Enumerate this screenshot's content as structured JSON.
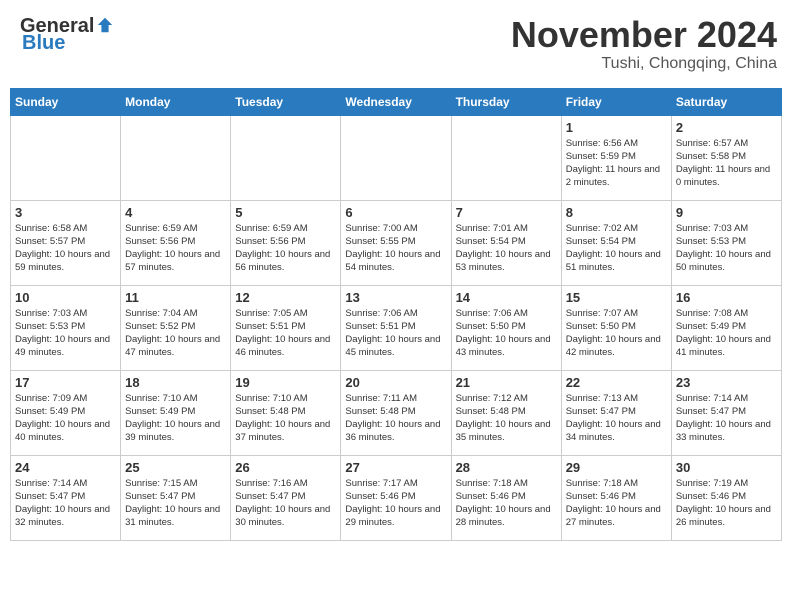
{
  "header": {
    "logo_general": "General",
    "logo_blue": "Blue",
    "month_title": "November 2024",
    "location": "Tushi, Chongqing, China"
  },
  "weekdays": [
    "Sunday",
    "Monday",
    "Tuesday",
    "Wednesday",
    "Thursday",
    "Friday",
    "Saturday"
  ],
  "weeks": [
    [
      {
        "day": "",
        "info": ""
      },
      {
        "day": "",
        "info": ""
      },
      {
        "day": "",
        "info": ""
      },
      {
        "day": "",
        "info": ""
      },
      {
        "day": "",
        "info": ""
      },
      {
        "day": "1",
        "info": "Sunrise: 6:56 AM\nSunset: 5:59 PM\nDaylight: 11 hours and 2 minutes."
      },
      {
        "day": "2",
        "info": "Sunrise: 6:57 AM\nSunset: 5:58 PM\nDaylight: 11 hours and 0 minutes."
      }
    ],
    [
      {
        "day": "3",
        "info": "Sunrise: 6:58 AM\nSunset: 5:57 PM\nDaylight: 10 hours and 59 minutes."
      },
      {
        "day": "4",
        "info": "Sunrise: 6:59 AM\nSunset: 5:56 PM\nDaylight: 10 hours and 57 minutes."
      },
      {
        "day": "5",
        "info": "Sunrise: 6:59 AM\nSunset: 5:56 PM\nDaylight: 10 hours and 56 minutes."
      },
      {
        "day": "6",
        "info": "Sunrise: 7:00 AM\nSunset: 5:55 PM\nDaylight: 10 hours and 54 minutes."
      },
      {
        "day": "7",
        "info": "Sunrise: 7:01 AM\nSunset: 5:54 PM\nDaylight: 10 hours and 53 minutes."
      },
      {
        "day": "8",
        "info": "Sunrise: 7:02 AM\nSunset: 5:54 PM\nDaylight: 10 hours and 51 minutes."
      },
      {
        "day": "9",
        "info": "Sunrise: 7:03 AM\nSunset: 5:53 PM\nDaylight: 10 hours and 50 minutes."
      }
    ],
    [
      {
        "day": "10",
        "info": "Sunrise: 7:03 AM\nSunset: 5:53 PM\nDaylight: 10 hours and 49 minutes."
      },
      {
        "day": "11",
        "info": "Sunrise: 7:04 AM\nSunset: 5:52 PM\nDaylight: 10 hours and 47 minutes."
      },
      {
        "day": "12",
        "info": "Sunrise: 7:05 AM\nSunset: 5:51 PM\nDaylight: 10 hours and 46 minutes."
      },
      {
        "day": "13",
        "info": "Sunrise: 7:06 AM\nSunset: 5:51 PM\nDaylight: 10 hours and 45 minutes."
      },
      {
        "day": "14",
        "info": "Sunrise: 7:06 AM\nSunset: 5:50 PM\nDaylight: 10 hours and 43 minutes."
      },
      {
        "day": "15",
        "info": "Sunrise: 7:07 AM\nSunset: 5:50 PM\nDaylight: 10 hours and 42 minutes."
      },
      {
        "day": "16",
        "info": "Sunrise: 7:08 AM\nSunset: 5:49 PM\nDaylight: 10 hours and 41 minutes."
      }
    ],
    [
      {
        "day": "17",
        "info": "Sunrise: 7:09 AM\nSunset: 5:49 PM\nDaylight: 10 hours and 40 minutes."
      },
      {
        "day": "18",
        "info": "Sunrise: 7:10 AM\nSunset: 5:49 PM\nDaylight: 10 hours and 39 minutes."
      },
      {
        "day": "19",
        "info": "Sunrise: 7:10 AM\nSunset: 5:48 PM\nDaylight: 10 hours and 37 minutes."
      },
      {
        "day": "20",
        "info": "Sunrise: 7:11 AM\nSunset: 5:48 PM\nDaylight: 10 hours and 36 minutes."
      },
      {
        "day": "21",
        "info": "Sunrise: 7:12 AM\nSunset: 5:48 PM\nDaylight: 10 hours and 35 minutes."
      },
      {
        "day": "22",
        "info": "Sunrise: 7:13 AM\nSunset: 5:47 PM\nDaylight: 10 hours and 34 minutes."
      },
      {
        "day": "23",
        "info": "Sunrise: 7:14 AM\nSunset: 5:47 PM\nDaylight: 10 hours and 33 minutes."
      }
    ],
    [
      {
        "day": "24",
        "info": "Sunrise: 7:14 AM\nSunset: 5:47 PM\nDaylight: 10 hours and 32 minutes."
      },
      {
        "day": "25",
        "info": "Sunrise: 7:15 AM\nSunset: 5:47 PM\nDaylight: 10 hours and 31 minutes."
      },
      {
        "day": "26",
        "info": "Sunrise: 7:16 AM\nSunset: 5:47 PM\nDaylight: 10 hours and 30 minutes."
      },
      {
        "day": "27",
        "info": "Sunrise: 7:17 AM\nSunset: 5:46 PM\nDaylight: 10 hours and 29 minutes."
      },
      {
        "day": "28",
        "info": "Sunrise: 7:18 AM\nSunset: 5:46 PM\nDaylight: 10 hours and 28 minutes."
      },
      {
        "day": "29",
        "info": "Sunrise: 7:18 AM\nSunset: 5:46 PM\nDaylight: 10 hours and 27 minutes."
      },
      {
        "day": "30",
        "info": "Sunrise: 7:19 AM\nSunset: 5:46 PM\nDaylight: 10 hours and 26 minutes."
      }
    ]
  ]
}
